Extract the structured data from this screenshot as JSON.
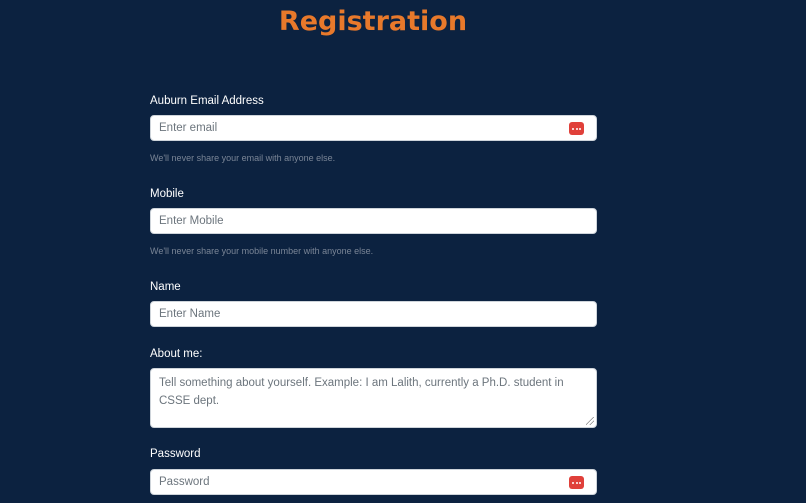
{
  "page": {
    "title": "Registration"
  },
  "form": {
    "email": {
      "label": "Auburn Email Address",
      "placeholder": "Enter email",
      "value": "",
      "help": "We'll never share your email with anyone else.",
      "icon": "password-manager-icon"
    },
    "mobile": {
      "label": "Mobile",
      "placeholder": "Enter Mobile",
      "value": "",
      "help": "We'll never share your mobile number with anyone else."
    },
    "name": {
      "label": "Name",
      "placeholder": "Enter Name",
      "value": ""
    },
    "about": {
      "label": "About me:",
      "placeholder": "Tell something about yourself. Example: I am Lalith, currently a Ph.D. student in CSSE dept.",
      "value": ""
    },
    "password": {
      "label": "Password",
      "placeholder": "Password",
      "value": "",
      "icon": "password-manager-icon"
    }
  },
  "colors": {
    "background": "#0c2240",
    "title": "#e8792b",
    "icon": "#e0403a",
    "help_text": "#7a8596"
  }
}
